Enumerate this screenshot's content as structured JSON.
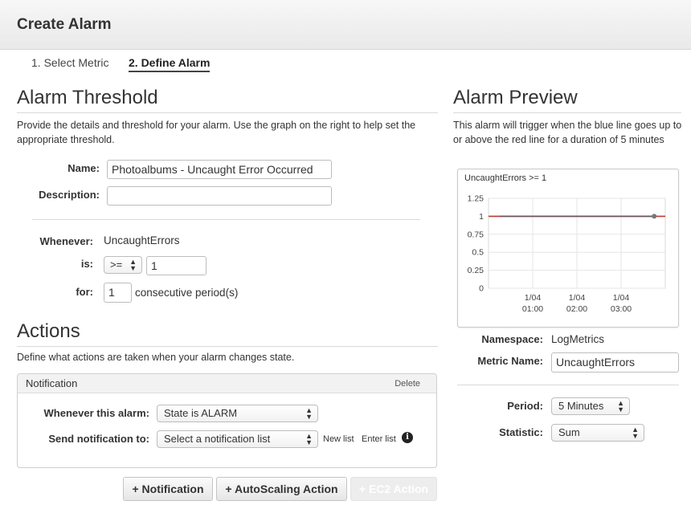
{
  "header": {
    "title": "Create Alarm"
  },
  "steps": [
    {
      "label": "1. Select Metric",
      "active": false
    },
    {
      "label": "2. Define Alarm",
      "active": true
    }
  ],
  "threshold": {
    "title": "Alarm Threshold",
    "description": "Provide the details and threshold for your alarm. Use the graph on the right to help set the appropriate threshold.",
    "name_label": "Name:",
    "name_value": "Photoalbums - Uncaught Error Occurred",
    "description_label": "Description:",
    "description_value": "",
    "whenever_label": "Whenever:",
    "whenever_value": "UncaughtErrors",
    "is_label": "is:",
    "operator": ">=",
    "threshold_value": "1",
    "for_label": "for:",
    "periods_value": "1",
    "periods_suffix": "consecutive period(s)"
  },
  "actions": {
    "title": "Actions",
    "description": "Define what actions are taken when your alarm changes state.",
    "notification": {
      "title": "Notification",
      "delete_label": "Delete",
      "whenever_label": "Whenever this alarm:",
      "state_value": "State is ALARM",
      "send_label": "Send notification to:",
      "list_value": "Select a notification list",
      "new_list": "New list",
      "enter_list": "Enter list",
      "info_icon": "info-icon"
    },
    "buttons": {
      "notification": "+ Notification",
      "autoscaling": "+ AutoScaling Action",
      "ec2": "+ EC2 Action"
    }
  },
  "preview": {
    "title": "Alarm Preview",
    "description": "This alarm will trigger when the blue line goes up to or above the red line for a duration of 5 minutes",
    "namespace_label": "Namespace:",
    "namespace_value": "LogMetrics",
    "metric_label": "Metric Name:",
    "metric_value": "UncaughtErrors",
    "period_label": "Period:",
    "period_value": "5 Minutes",
    "statistic_label": "Statistic:",
    "statistic_value": "Sum"
  },
  "chart_data": {
    "type": "line",
    "title": "UncaughtErrors >= 1",
    "y_ticks": [
      "1.25",
      "1",
      "0.75",
      "0.5",
      "0.25",
      "0"
    ],
    "x_ticks": [
      {
        "date": "1/04",
        "time": "01:00"
      },
      {
        "date": "1/04",
        "time": "02:00"
      },
      {
        "date": "1/04",
        "time": "03:00"
      }
    ],
    "ylim": [
      0,
      1.25
    ],
    "threshold": 1,
    "threshold_color": "#c0392b",
    "series_color": "#3b6fc4",
    "series": [
      {
        "x": [
          "00:15",
          "03:45"
        ],
        "values": [
          1,
          1
        ]
      }
    ],
    "grid": true
  }
}
